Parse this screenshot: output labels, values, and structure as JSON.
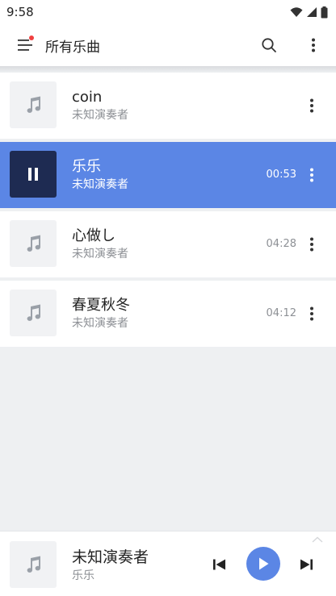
{
  "status_bar": {
    "time": "9:58"
  },
  "app_bar": {
    "title": "所有乐曲"
  },
  "songs": [
    {
      "title": "coin",
      "artist": "未知演奏者",
      "duration": ""
    },
    {
      "title": "乐乐",
      "artist": "未知演奏者",
      "duration": "00:53",
      "playing": true
    },
    {
      "title": "心做し",
      "artist": "未知演奏者",
      "duration": "04:28"
    },
    {
      "title": "春夏秋冬",
      "artist": "未知演奏者",
      "duration": "04:12"
    }
  ],
  "player": {
    "title": "未知演奏者",
    "subtitle": "乐乐"
  },
  "colors": {
    "accent": "#5b86e5",
    "active_cover": "#1e2b52",
    "menu_dot": "#f04040"
  },
  "icons": {
    "menu": "menu-icon",
    "search": "search-icon",
    "more": "more-vertical-icon",
    "music_note": "music-note-icon",
    "pause": "pause-icon",
    "play": "play-icon",
    "prev": "skip-previous-icon",
    "next": "skip-next-icon"
  }
}
